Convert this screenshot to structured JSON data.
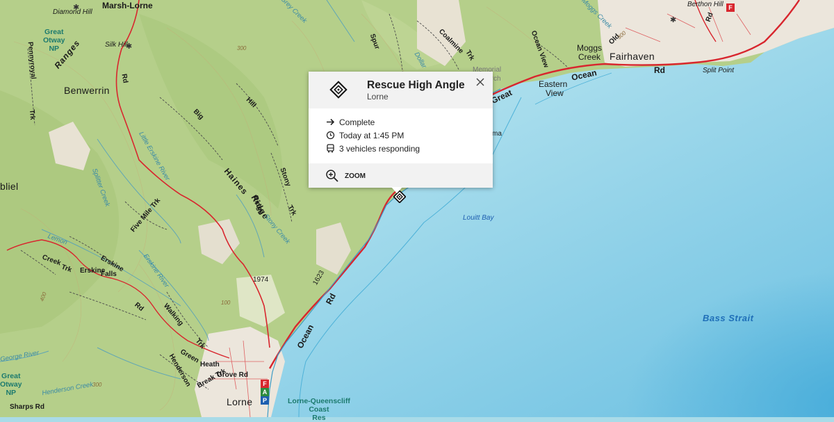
{
  "popup": {
    "title": "Rescue High Angle",
    "subtitle": "Lorne",
    "status": "Complete",
    "time": "Today at 1:45 PM",
    "vehicles": "3 vehicles responding",
    "zoom_label": "ZOOM",
    "icon": "incident-diamond-icon",
    "close_icon": "close-icon"
  },
  "map": {
    "towns": [
      "Fairhaven",
      "Benwerrin",
      "Lorne",
      "Eastern",
      "View",
      "Moggs",
      "Creek"
    ],
    "localities": [
      "Diamond Hill",
      "Silk Hill",
      "Marsh-Lorne",
      "Split Point",
      "Berthon Hill"
    ],
    "roads": [
      "Rd",
      "Ocean",
      "Rd",
      "Ocean",
      "Rd",
      "Great",
      "Erskine",
      "Falls",
      "Grove Rd",
      "Heath",
      "Green",
      "Break Trk",
      "Henderson",
      "Sharps Rd",
      "Coalmine",
      "Trk",
      "Old",
      "Rd",
      "Ocean View",
      "Spur",
      "Big",
      "Hill",
      "Stony",
      "Trk",
      "Five Mile Trk",
      "Walking",
      "Trk",
      "Rd",
      "Creek",
      "Trk",
      "Pennyroyal",
      "Trk",
      "Ridge",
      "Memorial",
      "Arch"
    ],
    "parks": [
      [
        "Great",
        "Otway",
        "NP"
      ],
      [
        "Great",
        "Otway",
        "NP"
      ]
    ],
    "ranges": [
      "Ranges",
      "Haines",
      "Ridge"
    ],
    "water_labels": [
      "Louitt Bay",
      "Bass Strait"
    ],
    "creeks": [
      "Little Erskine River",
      "Splitter Creek",
      "Erskine River",
      "Stony Creek",
      "Henderson Creek",
      "George River",
      "Grey Creek",
      "Lemon",
      "Dollar",
      "Moggs Creek"
    ],
    "coast_label": [
      "Lorne-Queenscliff",
      "Coast",
      "Res"
    ],
    "contours": [
      "300",
      "400",
      "100",
      "300",
      "1974",
      "300",
      "1623"
    ],
    "fragments": [
      "bliel",
      "Erskine",
      "ma"
    ],
    "facility_badges": [
      {
        "letter": "F",
        "color": "#d8262e"
      },
      {
        "letter": "A",
        "color": "#2e8b3e"
      },
      {
        "letter": "P",
        "color": "#1d5fb0"
      },
      {
        "letter": "F",
        "color": "#d8262e"
      }
    ]
  },
  "colors": {
    "forest": "#b7d18d",
    "sea_light": "#bfe4ee",
    "sea_deep": "#5db8dc",
    "main_road": "#d8262e",
    "urban": "#ece6dc",
    "popup_header": "#f2f2f2"
  }
}
